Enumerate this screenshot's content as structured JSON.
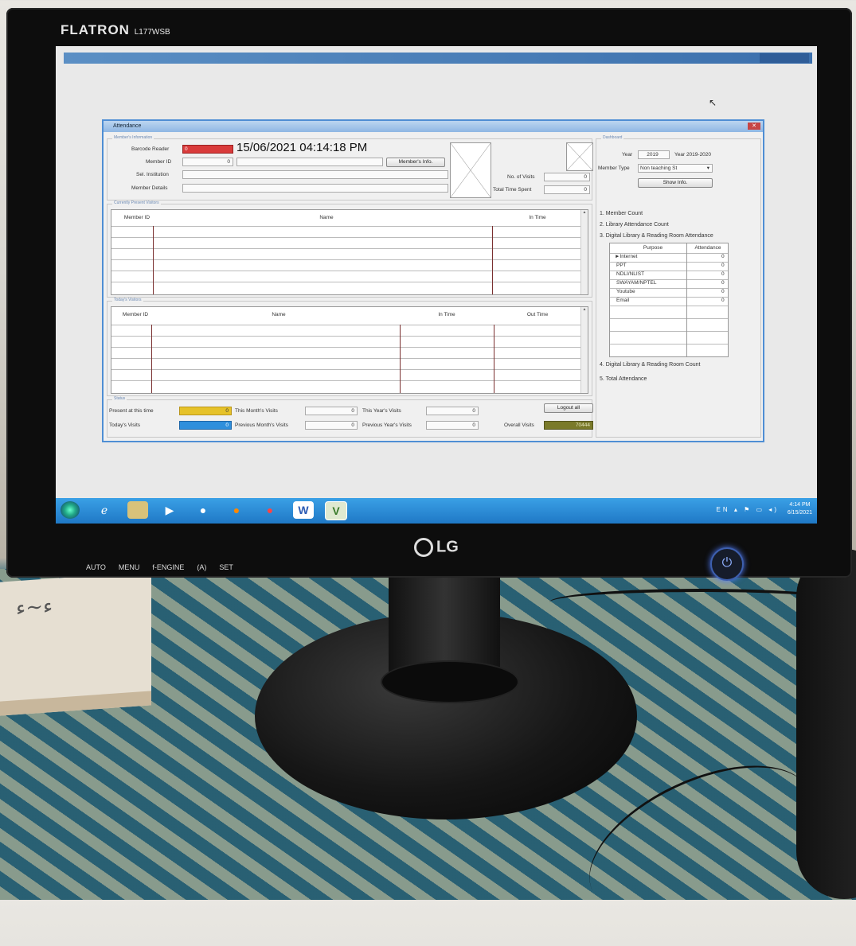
{
  "monitor": {
    "brand": "FLATRON",
    "model": "L177WSB",
    "logo": "LG",
    "buttons": [
      "AUTO",
      "MENU",
      "f-ENGINE",
      "(A)",
      "SET"
    ]
  },
  "window": {
    "title": "Attendance"
  },
  "member_info": {
    "group_title": "Member's Information",
    "barcode_label": "Barcode Reader",
    "barcode_value": "0",
    "datetime": "15/06/2021 04:14:18 PM",
    "member_id_label": "Member ID",
    "member_id_value": "0",
    "members_info_button": "Member's Info.",
    "sel_institution_label": "Sel. Institution",
    "member_details_label": "Member Details",
    "no_of_visits_label": "No. of Visits",
    "no_of_visits_value": "0",
    "total_time_spent_label": "Total Time Spent",
    "total_time_spent_value": "0"
  },
  "currently_present": {
    "group_title": "Currently Present Visitors",
    "columns": [
      "Member ID",
      "Name",
      "In Time"
    ]
  },
  "todays_visitors": {
    "group_title": "Today's Visitors",
    "columns": [
      "Member ID",
      "Name",
      "In Time",
      "Out Time"
    ]
  },
  "status": {
    "group_title": "Status",
    "present_label": "Present at this time",
    "present_value": "0",
    "todays_label": "Today's Visits",
    "todays_value": "0",
    "this_month_label": "This Month's Visits",
    "this_month_value": "0",
    "prev_month_label": "Previous Month's Visits",
    "prev_month_value": "0",
    "this_year_label": "This Year's Visits",
    "this_year_value": "0",
    "prev_year_label": "Previous Year's Visits",
    "prev_year_value": "0",
    "overall_label": "Overall Visits",
    "overall_value": "70444",
    "logout_button": "Logout all"
  },
  "dashboard": {
    "group_title": "Dashboard",
    "year_label": "Year",
    "year_value": "2019",
    "year_range": "Year 2019-2020",
    "member_type_label": "Member Type",
    "member_type_value": "Non teaching St",
    "show_info_button": "Show Info.",
    "items": [
      "1. Member Count",
      "2. Library Attendance Count",
      "3. Digital Library & Reading Room Attendance",
      "4. Digital Library & Reading Room Count",
      "5. Total Attendance"
    ],
    "table_headers": [
      "Purpose",
      "Attendance"
    ],
    "table_rows": [
      {
        "purpose": "Internet",
        "attendance": "0"
      },
      {
        "purpose": "PPT",
        "attendance": "0"
      },
      {
        "purpose": "NDLI/NLIST",
        "attendance": "0"
      },
      {
        "purpose": "SWAYAM/NPTEL",
        "attendance": "0"
      },
      {
        "purpose": "Youtube",
        "attendance": "0"
      },
      {
        "purpose": "Email",
        "attendance": "0"
      }
    ]
  },
  "taskbar": {
    "clock_time": "4:14 PM",
    "clock_date": "6/15/2021",
    "tray_lang": "EN"
  },
  "colors": {
    "barcode_red": "#d93b3b",
    "present_yellow": "#e6c229",
    "todays_blue": "#2f8fdc",
    "overall_olive": "#7a7a2a"
  }
}
